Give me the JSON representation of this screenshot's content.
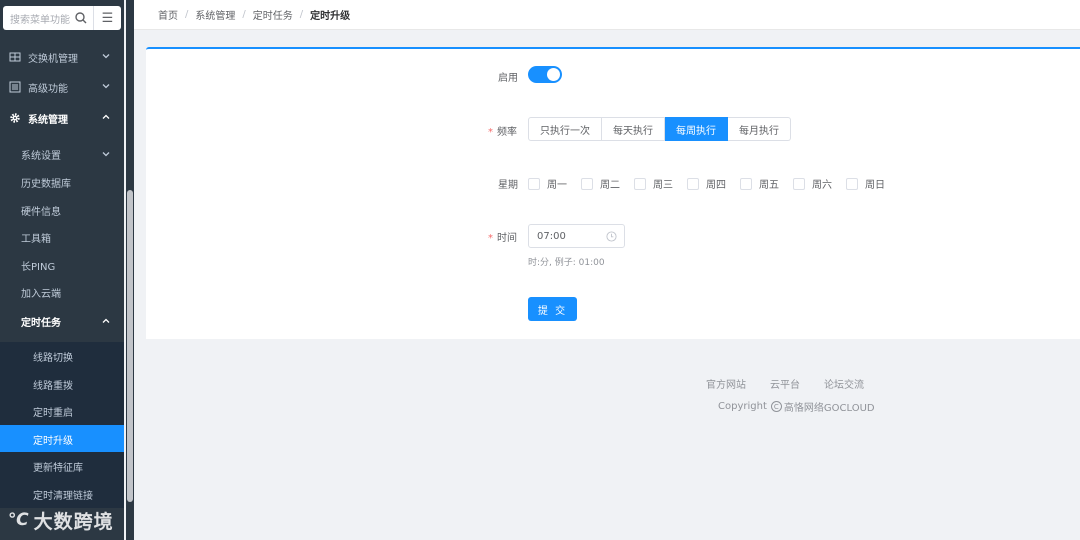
{
  "search": {
    "placeholder": "搜索菜单功能"
  },
  "sidebar": {
    "items": [
      {
        "label": "交换机管理",
        "icon": "switch-icon"
      },
      {
        "label": "高级功能",
        "icon": "advanced-icon"
      },
      {
        "label": "系统管理",
        "icon": "gear-icon"
      }
    ],
    "sub_items": [
      {
        "label": "系统设置"
      },
      {
        "label": "历史数据库"
      },
      {
        "label": "硬件信息"
      },
      {
        "label": "工具箱"
      },
      {
        "label": "长PING"
      },
      {
        "label": "加入云端"
      },
      {
        "label": "定时任务"
      }
    ],
    "task_items": [
      {
        "label": "线路切换"
      },
      {
        "label": "线路重拨"
      },
      {
        "label": "定时重启"
      },
      {
        "label": "定时升级"
      },
      {
        "label": "更新特征库"
      },
      {
        "label": "定时清理链接"
      }
    ]
  },
  "breadcrumb": [
    "首页",
    "系统管理",
    "定时任务",
    "定时升级"
  ],
  "breadcrumb_sep": "/",
  "form": {
    "enable_label": "启用",
    "enable_on": true,
    "frequency_label": "频率",
    "frequency_options": [
      "只执行一次",
      "每天执行",
      "每周执行",
      "每月执行"
    ],
    "frequency_selected": "每周执行",
    "weekday_label": "星期",
    "weekdays": [
      "周一",
      "周二",
      "周三",
      "周四",
      "周五",
      "周六",
      "周日"
    ],
    "time_label": "时间",
    "time_value": "07:00",
    "time_hint": "时:分, 例子: 01:00",
    "submit_label": "提 交"
  },
  "footer": {
    "links": [
      "官方网站",
      "云平台",
      "论坛交流"
    ],
    "copyright_prefix": "Copyright",
    "copyright_symbol": "C",
    "copyright_owner": "高恪网络GOCLOUD"
  },
  "watermark": {
    "logo": "℃",
    "text": "大数跨境"
  },
  "colors": {
    "accent": "#1890ff",
    "sidebar_bg": "#2c3843",
    "required": "#f56c6c"
  }
}
